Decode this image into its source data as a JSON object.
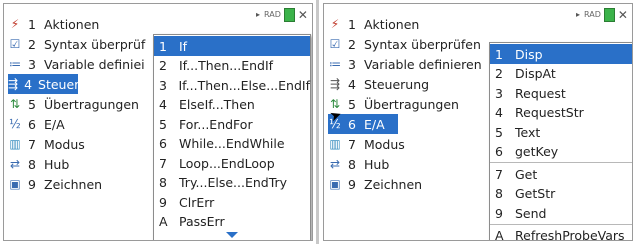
{
  "menu": {
    "items": [
      {
        "num": "1",
        "label": "Aktionen",
        "icon": "lightning-icon",
        "glyph": "⚡",
        "color": "#c0392b"
      },
      {
        "num": "2",
        "label": "Syntax überprüfen & speichern",
        "icon": "checkbox-icon",
        "glyph": "☑",
        "color": "#3a6bb0"
      },
      {
        "num": "3",
        "label": "Variable definieren",
        "icon": "variable-icon",
        "glyph": "≔",
        "color": "#3a6bb0"
      },
      {
        "num": "4",
        "label": "Steuerung",
        "icon": "control-icon",
        "glyph": "⇶",
        "color": "#555555"
      },
      {
        "num": "5",
        "label": "Übertragungen",
        "icon": "transfer-icon",
        "glyph": "⇅",
        "color": "#2e8b3e"
      },
      {
        "num": "6",
        "label": "E/A",
        "icon": "io-icon",
        "glyph": "½",
        "color": "#3a6bb0"
      },
      {
        "num": "7",
        "label": "Modus",
        "icon": "mode-icon",
        "glyph": "▥",
        "color": "#3a8fc0"
      },
      {
        "num": "8",
        "label": "Hub",
        "icon": "hub-icon",
        "glyph": "⇄",
        "color": "#3a6bb0"
      },
      {
        "num": "9",
        "label": "Zeichnen",
        "icon": "draw-icon",
        "glyph": "▣",
        "color": "#3a6bb0"
      }
    ]
  },
  "left_panel": {
    "truncated": {
      "item2": "Syntax überprüf",
      "item3": "Variable definiei"
    },
    "selected": "4",
    "submenu": [
      {
        "key": "1",
        "label": "If"
      },
      {
        "key": "2",
        "label": "If...Then...EndIf"
      },
      {
        "key": "3",
        "label": "If...Then...Else...EndIf"
      },
      {
        "key": "4",
        "label": "ElseIf...Then"
      },
      {
        "key": "5",
        "label": "For...EndFor"
      },
      {
        "key": "6",
        "label": "While...EndWhile"
      },
      {
        "key": "7",
        "label": "Loop...EndLoop"
      },
      {
        "key": "8",
        "label": "Try...Else...EndTry"
      },
      {
        "key": "9",
        "label": "ClrErr"
      },
      {
        "key": "A",
        "label": "PassErr"
      }
    ]
  },
  "right_panel": {
    "truncated": {
      "item2": "Syntax überprüfen",
      "item3": "Variable definieren"
    },
    "selected": "6",
    "submenu": [
      {
        "key": "1",
        "label": "Disp"
      },
      {
        "key": "2",
        "label": "DispAt"
      },
      {
        "key": "3",
        "label": "Request"
      },
      {
        "key": "4",
        "label": "RequestStr"
      },
      {
        "key": "5",
        "label": "Text"
      },
      {
        "key": "6",
        "label": "getKey"
      },
      {
        "key": "7",
        "label": "Get"
      },
      {
        "key": "8",
        "label": "GetStr"
      },
      {
        "key": "9",
        "label": "Send"
      },
      {
        "key": "A",
        "label": "RefreshProbeVars"
      }
    ]
  },
  "status": {
    "mode": "RAD",
    "accent": "#2a70c8",
    "battery_color": "#3bb34a"
  }
}
